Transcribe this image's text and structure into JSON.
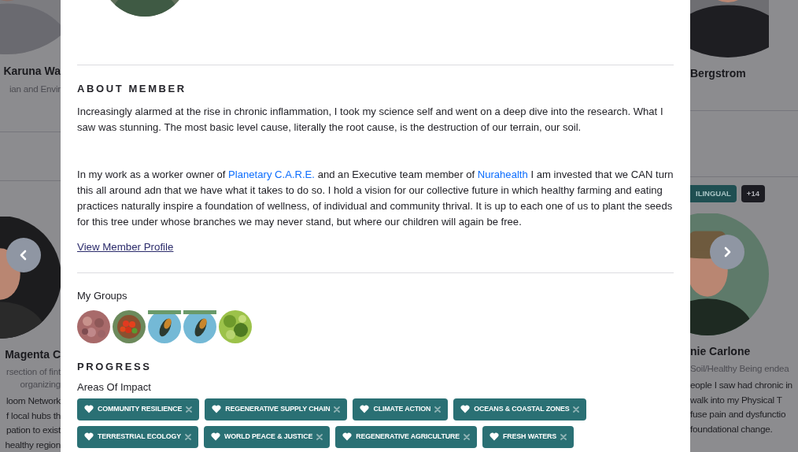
{
  "left_column": {
    "top_card": {
      "name": "Karuna Wa",
      "subtitle": "ian and Envir"
    },
    "member_card": {
      "name": "Magenta C",
      "subtitle_lines": [
        "rsection of fint",
        "organizing"
      ],
      "bio_lines": [
        "loom Network",
        "f local hubs th",
        "pation to exist",
        "healthy region"
      ]
    }
  },
  "right_column": {
    "top_card": {
      "name": "Bergstrom"
    },
    "member_card": {
      "tags": [
        {
          "label": "ILINGUAL",
          "kind": "skill"
        },
        {
          "label": "+14",
          "kind": "more"
        }
      ],
      "name": "nie Carlone",
      "subtitle_lines": [
        "Soil/Healthy Being endea"
      ],
      "bio_lines": [
        "eople I saw had chronic in",
        "walk into my Physical T",
        "fuse pain and dysfunctio",
        "foundational change."
      ]
    }
  },
  "modal": {
    "about_heading": "ABOUT MEMBER",
    "paragraphs": [
      [
        {
          "kind": "text",
          "text": "Increasingly alarmed at the rise in chronic inflammation, I took my science self and went on a deep dive into the research. What I saw was stunning. The most basic level cause,  literally the root cause, is the destruction of our terrain, our soil."
        }
      ],
      [
        {
          "kind": "text",
          "text": "In my work as a worker owner of "
        },
        {
          "kind": "link",
          "text": "Planetary C.A.R.E."
        },
        {
          "kind": "text",
          "text": " and an Executive team member of "
        },
        {
          "kind": "link",
          "text": "Nurahealth"
        },
        {
          "kind": "text",
          "text": " I am invested that we CAN turn this all around adn that we have what it takes to do so. I hold a vision for our collective future in which healthy farming and eating practices naturally inspire a foundation of wellness, of individual and community thrival. It is up to each one of us to plant the seeds for this tree under whose branches we may never stand, but where our children will again be free."
        }
      ]
    ],
    "profile_link": "View Member Profile",
    "groups_label": "My Groups",
    "groups": [
      {
        "kind": "picture"
      },
      {
        "kind": "picture"
      },
      {
        "kind": "picture"
      },
      {
        "kind": "picture"
      },
      {
        "kind": "picture"
      }
    ],
    "progress_heading": "PROGRESS",
    "impact_label": "Areas Of Impact",
    "impact_tags": [
      "COMMUNITY RESILIENCE",
      "REGENERATIVE SUPPLY CHAIN",
      "CLIMATE ACTION",
      "OCEANS & COASTAL ZONES",
      "TERRESTRIAL ECOLOGY",
      "WORLD PEACE & JUSTICE",
      "REGENERATIVE AGRICULTURE",
      "FRESH WATERS"
    ]
  }
}
